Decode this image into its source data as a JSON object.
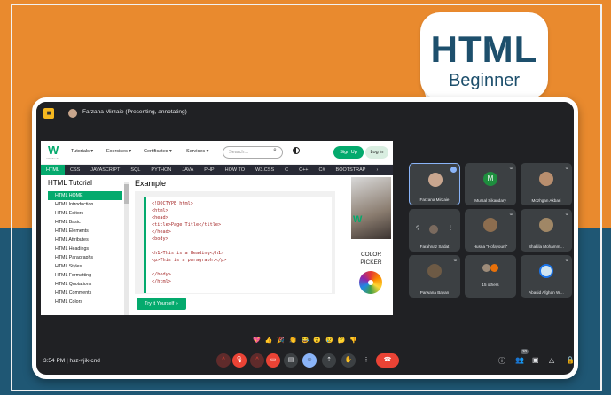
{
  "bubble": {
    "title": "HTML",
    "subtitle": "Beginner"
  },
  "meeting": {
    "app_icon": "slides-icon",
    "presenter_text": "Farzana Mirzaie (Presenting, annotating)",
    "time": "3:54 PM",
    "meeting_code": "hsz-vjik-cnd",
    "people_count": "20"
  },
  "w3": {
    "logo_letter": "W",
    "logo_sub": "w3schools",
    "menu": [
      "Tutorials ▾",
      "Exercises ▾",
      "Certificates ▾",
      "Services ▾"
    ],
    "search_placeholder": "Search...",
    "signup": "Sign Up",
    "login": "Log in",
    "nav": [
      "HTML",
      "CSS",
      "JAVASCRIPT",
      "SQL",
      "PYTHON",
      "JAVA",
      "PHP",
      "HOW TO",
      "W3.CSS",
      "C",
      "C++",
      "C#",
      "BOOTSTRAP",
      "›"
    ],
    "sidebar_title": "HTML Tutorial",
    "sidebar_items": [
      "HTML HOME",
      "HTML Introduction",
      "HTML Editors",
      "HTML Basic",
      "HTML Elements",
      "HTML Attributes",
      "HTML Headings",
      "HTML Paragraphs",
      "HTML Styles",
      "HTML Formatting",
      "HTML Quotations",
      "HTML Comments",
      "HTML Colors"
    ],
    "main_title": "Example",
    "code": [
      "<!DOCTYPE html>",
      "<html>",
      "<head>",
      "<title>Page Title</title>",
      "</head>",
      "<body>",
      "",
      "<h1>This is a Heading</h1>",
      "<p>This is a paragraph.</p>",
      "",
      "</body>",
      "</html>"
    ],
    "try_button": "Try it Yourself »",
    "ad_line1": "COLOR",
    "ad_line2": "PICKER"
  },
  "participants": [
    {
      "name": "Farzana Mirzaie",
      "avatar": "#c9a68f"
    },
    {
      "name": "Mursal Sikandary",
      "avatar": "#1e8e3e",
      "initial": "M"
    },
    {
      "name": "Mozhgan Akbari",
      "avatar": "#b88e6e"
    },
    {
      "name": "Farahnaz Sadat",
      "avatar": "#7a6a5e"
    },
    {
      "name": "Husna \"Hofayouni\"",
      "avatar": "#8c6d4f"
    },
    {
      "name": "Shakila Mohamm…",
      "avatar": "#a08766"
    },
    {
      "name": "Parwana Bayan",
      "avatar": "#6d5a45"
    },
    {
      "name": "15 others",
      "avatar": "#9e8c7a"
    },
    {
      "name": "Abasid Afghan W…",
      "avatar": "#d0e4f0"
    }
  ],
  "emojis": "💖 👍 🎉 👏 😂 😮 😢 🤔 👎",
  "colors": {
    "accent": "#04aa6d",
    "orange": "#e98a2e",
    "navy": "#1f5774",
    "end_call": "#ea4335"
  }
}
